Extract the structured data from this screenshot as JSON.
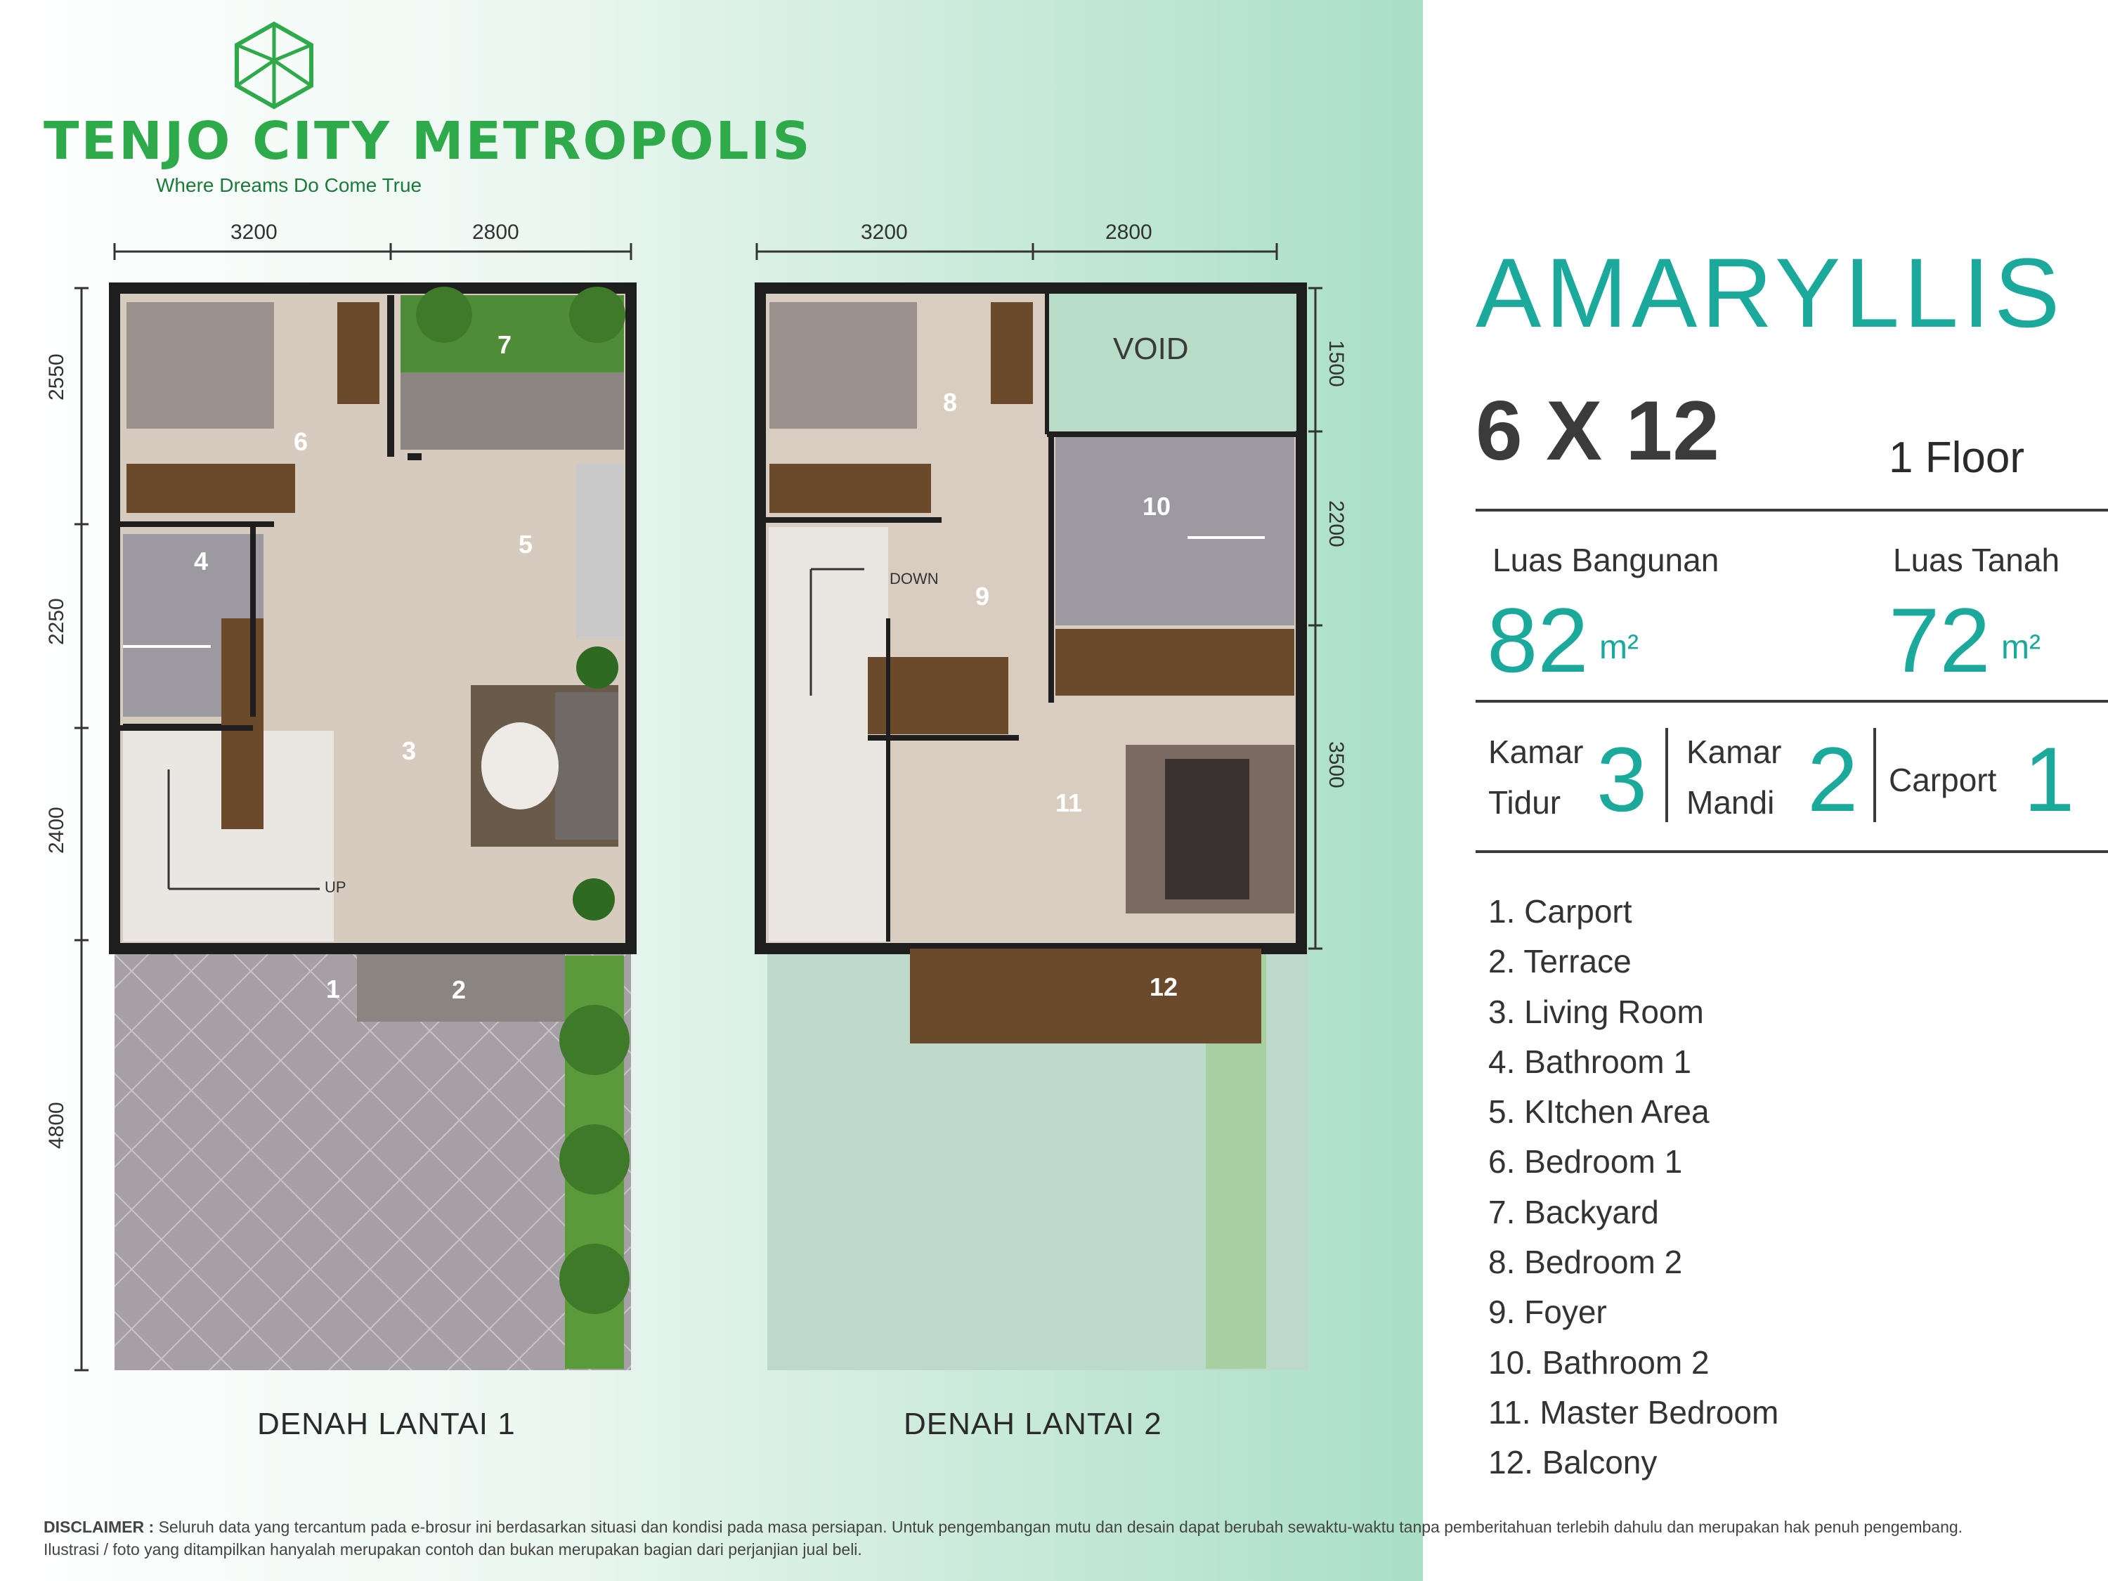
{
  "brand": {
    "name": "TENJO CITY METROPOLIS",
    "tagline": "Where Dreams Do Come True",
    "color": "#2faa4a"
  },
  "plans": {
    "floor1": {
      "title": "DENAH LANTAI 1",
      "dims_top": [
        "3200",
        "2800"
      ],
      "dims_left": [
        "2550",
        "2250",
        "2400",
        "4800"
      ],
      "stair_label": "UP",
      "rooms": [
        "1",
        "2",
        "3",
        "4",
        "5",
        "6",
        "7"
      ]
    },
    "floor2": {
      "title": "DENAH LANTAI 2",
      "dims_top": [
        "3200",
        "2800"
      ],
      "dims_right": [
        "1500",
        "2200",
        "3500"
      ],
      "stair_label": "DOWN",
      "void_label": "VOID",
      "rooms": [
        "8",
        "9",
        "10",
        "11",
        "12"
      ]
    }
  },
  "info": {
    "title": "AMARYLLIS",
    "size": "6 X 12",
    "floors": "1 Floor",
    "building_area": {
      "label": "Luas Bangunan",
      "value": "82",
      "unit": "m²"
    },
    "land_area": {
      "label": "Luas Tanah",
      "value": "72",
      "unit": "m²"
    },
    "specs": [
      {
        "label_line1": "Kamar",
        "label_line2": "Tidur",
        "value": "3"
      },
      {
        "label_line1": "Kamar",
        "label_line2": "Mandi",
        "value": "2"
      },
      {
        "label_line1": "Carport",
        "label_line2": "",
        "value": "1"
      }
    ],
    "accent_color": "#1aa99a",
    "legend": [
      "1. Carport",
      "2. Terrace",
      "3. Living Room",
      "4. Bathroom 1",
      "5. KItchen Area",
      "6. Bedroom 1",
      "7. Backyard",
      "8. Bedroom 2",
      "9. Foyer",
      "10. Bathroom 2",
      "11. Master Bedroom",
      "12. Balcony"
    ]
  },
  "disclaimer": {
    "label": "DISCLAIMER :",
    "text": "Seluruh data yang tercantum pada e-brosur ini berdasarkan situasi dan kondisi pada masa persiapan. Untuk pengembangan mutu  dan desain dapat berubah sewaktu-waktu tanpa pemberitahuan terlebih dahulu dan merupakan hak penuh pengembang.",
    "text2": "Ilustrasi / foto yang ditampilkan hanyalah merupakan contoh dan bukan merupakan bagian dari perjanjian jual beli."
  }
}
